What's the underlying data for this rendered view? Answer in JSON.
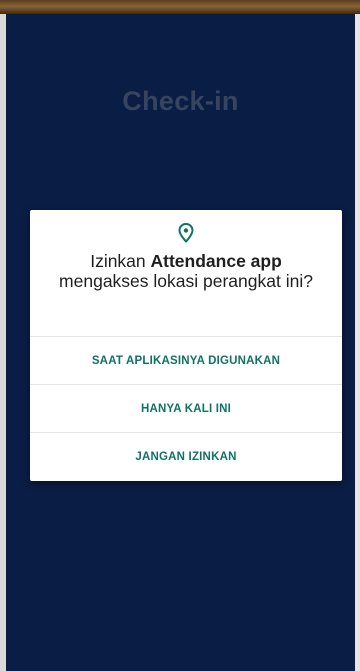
{
  "screen": {
    "title": "Check-in",
    "background_color": "#0a1d45"
  },
  "permission_dialog": {
    "icon": "location-pin-icon",
    "accent_color": "#107266",
    "message_prefix": "Izinkan ",
    "app_name": "Attendance app",
    "message_suffix": " mengakses lokasi perangkat ini?",
    "buttons": {
      "while_using": "SAAT APLIKASINYA DIGUNAKAN",
      "only_this_time": "HANYA KALI INI",
      "deny": "JANGAN IZINKAN"
    }
  }
}
